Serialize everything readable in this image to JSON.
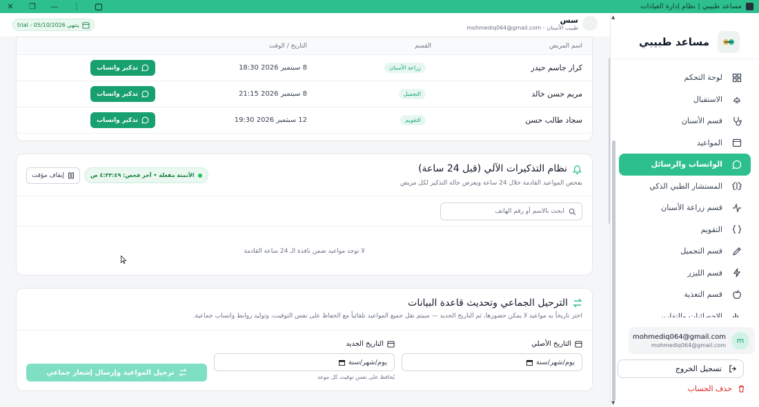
{
  "window": {
    "title": "مساعد طبيبي | نظام إدارة العيادات",
    "controls": [
      "close-icon",
      "restore-icon",
      "minimize-icon",
      "more-icon",
      "extension-icon"
    ]
  },
  "header": {
    "trial_label": "trial - ينتهي 05/10/2026",
    "profile_name": "سس",
    "profile_role": "طبيب الأسنان - mohmediq064@gmail.com"
  },
  "sidebar": {
    "brand": "مساعد طبيبي",
    "items": [
      {
        "label": "لوحة التحكم",
        "icon": "dashboard-icon"
      },
      {
        "label": "الاستقبال",
        "icon": "reception-bell-icon"
      },
      {
        "label": "قسم الأسنان",
        "icon": "stethoscope-icon"
      },
      {
        "label": "المواعيد",
        "icon": "calendar-icon"
      },
      {
        "label": "الواتساب والرسائل",
        "icon": "message-icon",
        "active": true
      },
      {
        "label": "المستشار الطبي الذكي",
        "icon": "brain-icon"
      },
      {
        "label": "قسم زراعة الأسنان",
        "icon": "activity-icon"
      },
      {
        "label": "التقويم",
        "icon": "braces-icon"
      },
      {
        "label": "قسم التجميل",
        "icon": "pen-icon"
      },
      {
        "label": "قسم الليزر",
        "icon": "lightning-icon"
      },
      {
        "label": "قسم التغذية",
        "icon": "apple-icon"
      },
      {
        "label": "الاحصائيات والتقارير",
        "icon": "chart-icon"
      }
    ],
    "user_email": "mohmediq064@gmail.com",
    "user_email_sub": "mohmediq064@gmail.com",
    "avatar_letter": "m",
    "logout_label": "تسجيل الخروج",
    "delete_label": "حذف الحساب"
  },
  "appointments_table": {
    "headers": {
      "name": "اسم المريض",
      "dept": "القسم",
      "date": "التاريخ / الوقت"
    },
    "rows": [
      {
        "name": "كرار جاسم حيدر",
        "dept": "زراعة الأسنان",
        "date": "8 سبتمبر 2026 18:30",
        "action": "تذكير واتساب"
      },
      {
        "name": "مريم حسن خالد",
        "dept": "التجميل",
        "date": "8 سبتمبر 2026 21:15",
        "action": "تذكير واتساب"
      },
      {
        "name": "سجاد طالب حسن",
        "dept": "التقويم",
        "date": "12 سبتمبر 2026 19:30",
        "action": "تذكير واتساب"
      }
    ]
  },
  "reminders": {
    "title": "نظام التذكيرات الآلي (قبل 24 ساعة)",
    "subtitle": "يفحص المواعيد القادمة خلال 24 ساعة ويعرض حالة التذكير لكل مريض",
    "status": "الأتمتة مفعلة • آخر فحص: ٤:٣٣:٤٩ ص",
    "pause_label": "إيقاف مؤقت",
    "search_placeholder": "ابحث بالاسم أو رقم الهاتف",
    "empty_text": "لا توجد مواعيد ضمن نافذة الـ 24 ساعة القادمة"
  },
  "bulk": {
    "title": "الترحيل الجماعي وتحديث قاعدة البيانات",
    "subtitle": "اختر تاريخاً به مواعيد لا يمكن حضورها، ثم التاريخ الجديد — سيتم نقل جميع المواعيد تلقائياً مع الحفاظ على نفس التوقيت، وتوليد روابط واتساب جماعية.",
    "original_label": "التاريخ الأصلي",
    "new_label": "التاريخ الجديد",
    "date_placeholder": "يوم/شهر/سنة",
    "hint": "يُحافظ على نفس توقيت كل موعد",
    "button": "ترحيل المواعيد وإرسال إشعار جماعي"
  },
  "colors": {
    "accent": "#2ebf8f",
    "button": "#18a06e",
    "disabled": "#7fdfc2",
    "danger": "#dc2626"
  }
}
